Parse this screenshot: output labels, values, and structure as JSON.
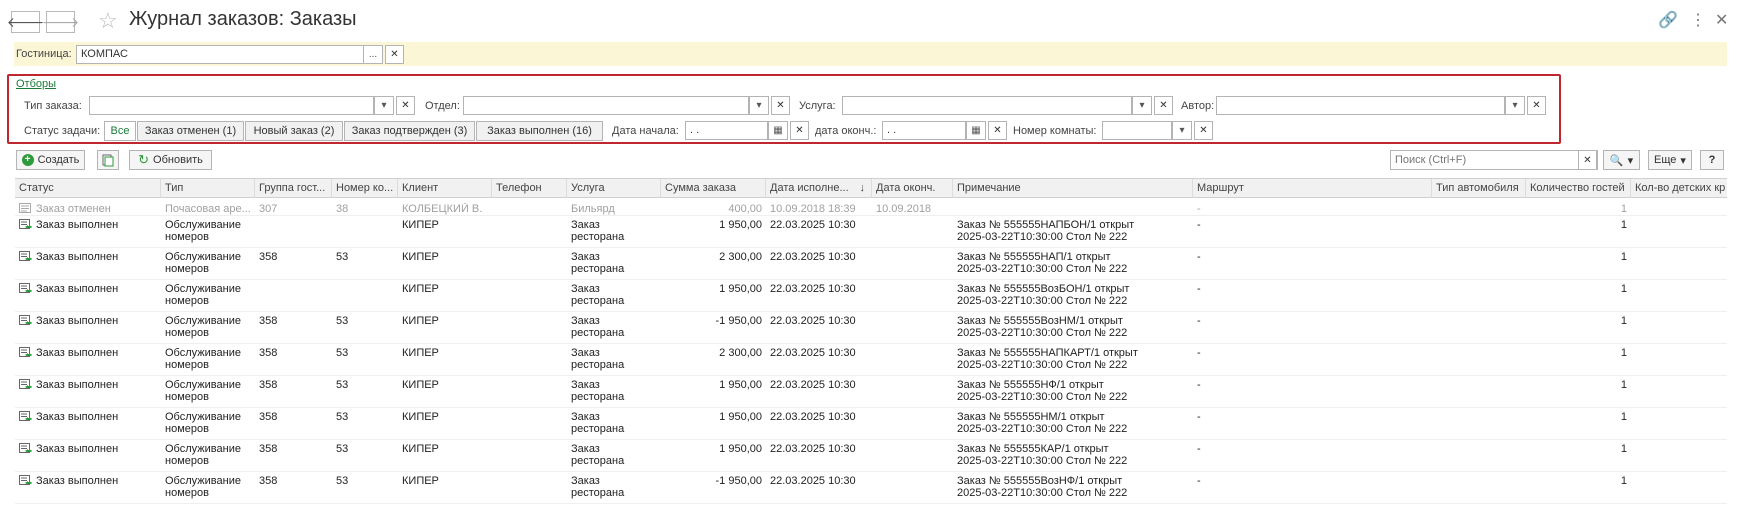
{
  "window": {
    "title": "Журнал заказов: Заказы",
    "back_icon": "arrow-left-icon",
    "forward_icon": "arrow-right-icon",
    "back_glyph": "🡐",
    "forward_glyph": "🡒",
    "star_glyph": "☆",
    "link_glyph": "🔗",
    "menu_glyph": "⋮",
    "close_glyph": "✕"
  },
  "hotel": {
    "label": "Гостиница:",
    "value": "КОМПАС",
    "select_glyph": "...",
    "clear_glyph": "✕"
  },
  "filters": {
    "link": "Отборы",
    "order_type": {
      "label": "Тип заказа:",
      "value": ""
    },
    "department": {
      "label": "Отдел:",
      "value": ""
    },
    "service": {
      "label": "Услуга:",
      "value": ""
    },
    "author": {
      "label": "Автор:",
      "value": ""
    },
    "task_status_label": "Статус задачи:",
    "status_buttons": [
      "Все",
      "Заказ отменен (1)",
      "Новый заказ (2)",
      "Заказ подтвержден (3)",
      "Заказ выполнен (16)"
    ],
    "start_date": {
      "label": "Дата начала:",
      "value": " .  ."
    },
    "end_date": {
      "label": "дата оконч.:",
      "value": " .  ."
    },
    "room_number": {
      "label": "Номер комнаты:",
      "value": ""
    },
    "dropdown_glyph": "▾",
    "clear_glyph": "✕",
    "calendar_glyph": "▦"
  },
  "toolbar": {
    "create_label": "Создать",
    "refresh_label": "Обновить",
    "search_placeholder": "Поиск (Ctrl+F)",
    "more_label": "Еще",
    "help_label": "?",
    "plus_glyph": "+",
    "refresh_glyph": "↻",
    "search_glyph": "🔍"
  },
  "table": {
    "columns": [
      "Статус",
      "Тип",
      "Группа гост...",
      "Номер ко...",
      "Клиент",
      "Телефон",
      "Услуга",
      "Сумма заказа",
      "Дата исполне...",
      "Дата оконч.",
      "Примечание",
      "Маршрут",
      "Тип автомобиля",
      "Количество гостей",
      "Кол-во детских кр"
    ],
    "sort_glyph": "↓",
    "rows": [
      {
        "status": "Заказ отменен",
        "type": [
          "Почасовая аре..."
        ],
        "group": "307",
        "room": "38",
        "client": "КОЛБЕЦКИЙ В.",
        "phone": "",
        "service": [
          "Бильярд"
        ],
        "sum": "400,00",
        "exec_date": "10.09.2018 18:39",
        "end_date": "10.09.2018",
        "note": [],
        "route": "-",
        "car": "",
        "guests": "1",
        "muted": true
      },
      {
        "status": "Заказ выполнен",
        "type": [
          "Обслуживание",
          "номеров"
        ],
        "group": "",
        "room": "",
        "client": "КИПЕР",
        "phone": "",
        "service": [
          "Заказ",
          "ресторана"
        ],
        "sum": "1 950,00",
        "exec_date": "22.03.2025 10:30",
        "end_date": "",
        "note": [
          "Заказ № 555555НАПБОН/1 открыт",
          "2025-03-22T10:30:00 Стол № 222"
        ],
        "route": "-",
        "car": "",
        "guests": "1"
      },
      {
        "status": "Заказ выполнен",
        "type": [
          "Обслуживание",
          "номеров"
        ],
        "group": "358",
        "room": "53",
        "client": "КИПЕР",
        "phone": "",
        "service": [
          "Заказ",
          "ресторана"
        ],
        "sum": "2 300,00",
        "exec_date": "22.03.2025 10:30",
        "end_date": "",
        "note": [
          "Заказ № 555555НАП/1 открыт",
          "2025-03-22T10:30:00 Стол № 222"
        ],
        "route": "-",
        "car": "",
        "guests": "1"
      },
      {
        "status": "Заказ выполнен",
        "type": [
          "Обслуживание",
          "номеров"
        ],
        "group": "",
        "room": "",
        "client": "КИПЕР",
        "phone": "",
        "service": [
          "Заказ",
          "ресторана"
        ],
        "sum": "1 950,00",
        "exec_date": "22.03.2025 10:30",
        "end_date": "",
        "note": [
          "Заказ № 555555ВозБОН/1 открыт",
          "2025-03-22T10:30:00 Стол № 222"
        ],
        "route": "-",
        "car": "",
        "guests": "1"
      },
      {
        "status": "Заказ выполнен",
        "type": [
          "Обслуживание",
          "номеров"
        ],
        "group": "358",
        "room": "53",
        "client": "КИПЕР",
        "phone": "",
        "service": [
          "Заказ",
          "ресторана"
        ],
        "sum": "-1 950,00",
        "exec_date": "22.03.2025 10:30",
        "end_date": "",
        "note": [
          "Заказ № 555555ВозНМ/1 открыт",
          "2025-03-22T10:30:00 Стол № 222"
        ],
        "route": "-",
        "car": "",
        "guests": "1"
      },
      {
        "status": "Заказ выполнен",
        "type": [
          "Обслуживание",
          "номеров"
        ],
        "group": "358",
        "room": "53",
        "client": "КИПЕР",
        "phone": "",
        "service": [
          "Заказ",
          "ресторана"
        ],
        "sum": "2 300,00",
        "exec_date": "22.03.2025 10:30",
        "end_date": "",
        "note": [
          "Заказ № 555555НАПКАРТ/1 открыт",
          "2025-03-22T10:30:00 Стол № 222"
        ],
        "route": "-",
        "car": "",
        "guests": "1"
      },
      {
        "status": "Заказ выполнен",
        "type": [
          "Обслуживание",
          "номеров"
        ],
        "group": "358",
        "room": "53",
        "client": "КИПЕР",
        "phone": "",
        "service": [
          "Заказ",
          "ресторана"
        ],
        "sum": "1 950,00",
        "exec_date": "22.03.2025 10:30",
        "end_date": "",
        "note": [
          "Заказ № 555555НФ/1 открыт",
          "2025-03-22T10:30:00 Стол № 222"
        ],
        "route": "-",
        "car": "",
        "guests": "1"
      },
      {
        "status": "Заказ выполнен",
        "type": [
          "Обслуживание",
          "номеров"
        ],
        "group": "358",
        "room": "53",
        "client": "КИПЕР",
        "phone": "",
        "service": [
          "Заказ",
          "ресторана"
        ],
        "sum": "1 950,00",
        "exec_date": "22.03.2025 10:30",
        "end_date": "",
        "note": [
          "Заказ № 555555НМ/1 открыт",
          "2025-03-22T10:30:00 Стол № 222"
        ],
        "route": "-",
        "car": "",
        "guests": "1"
      },
      {
        "status": "Заказ выполнен",
        "type": [
          "Обслуживание",
          "номеров"
        ],
        "group": "358",
        "room": "53",
        "client": "КИПЕР",
        "phone": "",
        "service": [
          "Заказ",
          "ресторана"
        ],
        "sum": "1 950,00",
        "exec_date": "22.03.2025 10:30",
        "end_date": "",
        "note": [
          "Заказ № 555555КАР/1 открыт",
          "2025-03-22T10:30:00 Стол № 222"
        ],
        "route": "-",
        "car": "",
        "guests": "1"
      },
      {
        "status": "Заказ выполнен",
        "type": [
          "Обслуживание",
          "номеров"
        ],
        "group": "358",
        "room": "53",
        "client": "КИПЕР",
        "phone": "",
        "service": [
          "Заказ",
          "ресторана"
        ],
        "sum": "-1 950,00",
        "exec_date": "22.03.2025 10:30",
        "end_date": "",
        "note": [
          "Заказ № 555555ВозНФ/1 открыт",
          "2025-03-22T10:30:00 Стол № 222"
        ],
        "route": "-",
        "car": "",
        "guests": "1"
      }
    ]
  },
  "colors": {
    "accent_green": "#1a7a3a",
    "highlight_red": "#c0262d",
    "hotel_bar": "#fbf6d6"
  }
}
